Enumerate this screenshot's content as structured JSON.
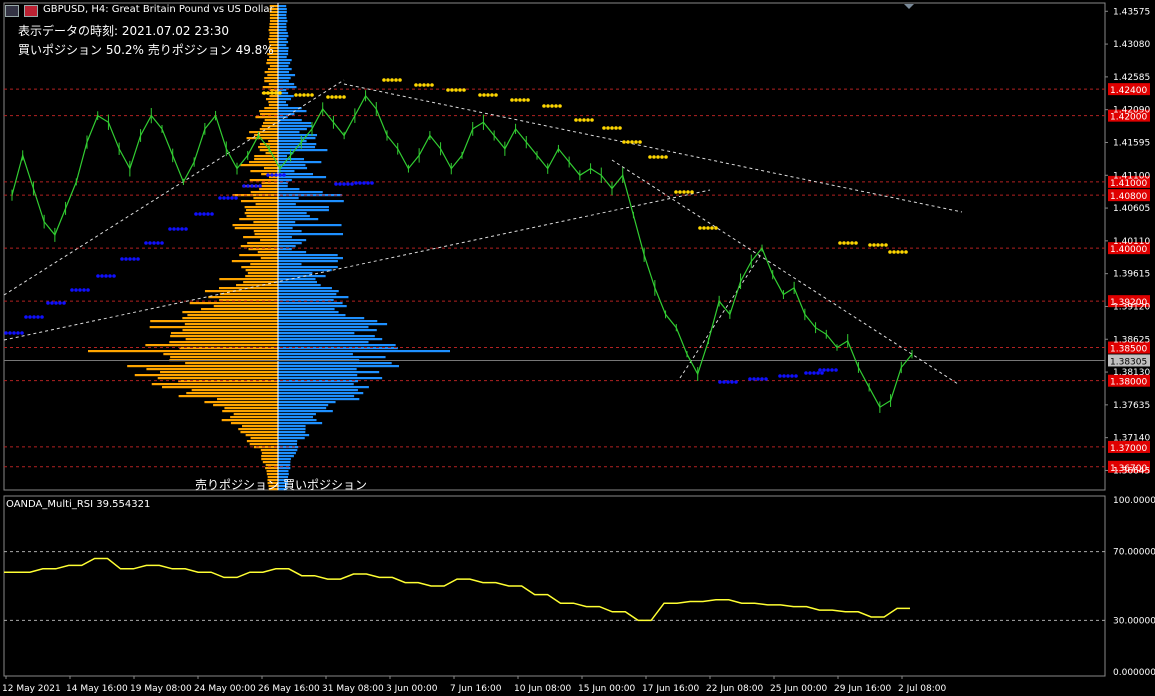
{
  "header": {
    "symbol_line": "GBPUSD, H4:  Great Britain Pound vs US Dollar",
    "time_label": "表示データの時刻: 2021.07.02 23:30",
    "position_line": "買いポジション 50.2% 売りポジション 49.8%",
    "sell_label": "売りポジション",
    "buy_label": "買いポジション"
  },
  "rsi_panel": {
    "title": "OANDA_Multi_RSI 39.554321",
    "scale_labels": [
      "100.00000",
      "70.000000",
      "30.000000",
      "0.000000"
    ]
  },
  "colors": {
    "background": "#000000",
    "candle": "#32cd32",
    "sell_bars": "#ffa500",
    "buy_bars": "#1e90ff",
    "resistance_dots": "#ffd700",
    "support_dots": "#1010ff",
    "level_lines": "#b22222",
    "level_tag": "#e00000",
    "rsi_line": "#ffff33",
    "price_tag": "#c0c0c0"
  },
  "chart_data": [
    {
      "type": "line",
      "title": "GBPUSD, H4",
      "y_axis_labels": [
        "1.43575",
        "1.43080",
        "1.42585",
        "1.42090",
        "1.41595",
        "1.41100",
        "1.40605",
        "1.40110",
        "1.39615",
        "1.39120",
        "1.38625",
        "1.38130",
        "1.37635",
        "1.37140",
        "1.36645"
      ],
      "ylim": [
        1.3635,
        1.437
      ],
      "x_axis_labels": [
        "12 May 2021",
        "14 May 16:00",
        "19 May 08:00",
        "24 May 00:00",
        "26 May 16:00",
        "31 May 08:00",
        "3 Jun 00:00",
        "7 Jun 16:00",
        "10 Jun 08:00",
        "15 Jun 00:00",
        "17 Jun 16:00",
        "22 Jun 08:00",
        "25 Jun 00:00",
        "29 Jun 16:00",
        "2 Jul 08:00"
      ],
      "current_price": "1.38305",
      "horizontal_levels": [
        {
          "label": "1.42400",
          "value": 1.424
        },
        {
          "label": "1.42000",
          "value": 1.42
        },
        {
          "label": "1.41000",
          "value": 1.41
        },
        {
          "label": "1.40800",
          "value": 1.408
        },
        {
          "label": "1.40000",
          "value": 1.4
        },
        {
          "label": "1.39200",
          "value": 1.392
        },
        {
          "label": "1.38500",
          "value": 1.385
        },
        {
          "label": "1.38000",
          "value": 1.38
        },
        {
          "label": "1.37000",
          "value": 1.37
        },
        {
          "label": "1.36700",
          "value": 1.367
        }
      ],
      "series": [
        {
          "values": [
            1.408,
            1.414,
            1.409,
            1.404,
            1.402,
            1.406,
            1.41,
            1.416,
            1.42,
            1.419,
            1.415,
            1.412,
            1.417,
            1.42,
            1.418,
            1.414,
            1.41,
            1.413,
            1.418,
            1.42,
            1.415,
            1.412,
            1.414,
            1.417,
            1.415,
            1.412,
            1.414,
            1.416,
            1.418,
            1.421,
            1.419,
            1.417,
            1.42,
            1.423,
            1.421,
            1.417,
            1.415,
            1.412,
            1.414,
            1.417,
            1.415,
            1.412,
            1.414,
            1.418,
            1.419,
            1.417,
            1.415,
            1.418,
            1.416,
            1.414,
            1.412,
            1.415,
            1.413,
            1.411,
            1.412,
            1.411,
            1.409,
            1.411,
            1.405,
            1.399,
            1.394,
            1.39,
            1.388,
            1.384,
            1.381,
            1.386,
            1.392,
            1.39,
            1.395,
            1.398,
            1.4,
            1.396,
            1.393,
            1.394,
            1.39,
            1.388,
            1.387,
            1.385,
            1.386,
            1.382,
            1.379,
            1.376,
            1.377,
            1.382,
            1.384
          ]
        }
      ]
    },
    {
      "type": "line",
      "title": "OANDA_Multi_RSI 39.554321",
      "ylim": [
        0,
        100
      ],
      "series": [
        {
          "values": [
            58,
            58,
            58,
            60,
            60,
            62,
            62,
            66,
            66,
            60,
            60,
            62,
            62,
            60,
            60,
            58,
            58,
            55,
            55,
            58,
            58,
            60,
            60,
            56,
            56,
            54,
            54,
            57,
            57,
            55,
            55,
            52,
            52,
            50,
            50,
            54,
            54,
            52,
            52,
            50,
            50,
            45,
            45,
            40,
            40,
            38,
            38,
            35,
            35,
            30,
            30,
            40,
            40,
            41,
            41,
            42,
            42,
            40,
            40,
            39,
            39,
            38,
            38,
            36,
            36,
            35,
            35,
            32,
            32,
            37,
            37
          ]
        }
      ]
    }
  ]
}
